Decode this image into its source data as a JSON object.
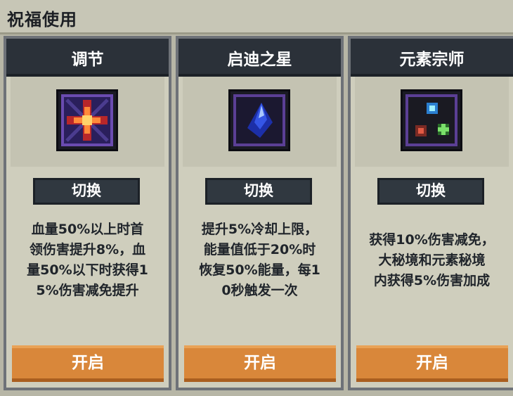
{
  "window": {
    "title": "祝福使用"
  },
  "cards": [
    {
      "name": "调节",
      "icon": "red-cross-star-icon",
      "switch_label": "切换",
      "description_lines": [
        "血量50%以上时首",
        "领伤害提升8%，血",
        "量50%以下时获得1",
        "5%伤害减免提升"
      ],
      "open_label": "开启"
    },
    {
      "name": "启迪之星",
      "icon": "blue-crystal-icon",
      "switch_label": "切换",
      "description_lines": [
        "提升5%冷却上限，",
        "能量值低于20%时",
        "恢复50%能量，每1",
        "0秒触发一次"
      ],
      "open_label": "开启"
    },
    {
      "name": "元素宗师",
      "icon": "elemental-orbs-icon",
      "switch_label": "切换",
      "description_lines": [
        "获得10%伤害减免，",
        "大秘境和元素秘境",
        "内获得5%伤害加成"
      ],
      "open_label": "开启"
    }
  ],
  "colors": {
    "background": "#b7b6a6",
    "header": "#2b3139",
    "open_button": "#d9873a",
    "icon_border": "#5b3f95"
  }
}
